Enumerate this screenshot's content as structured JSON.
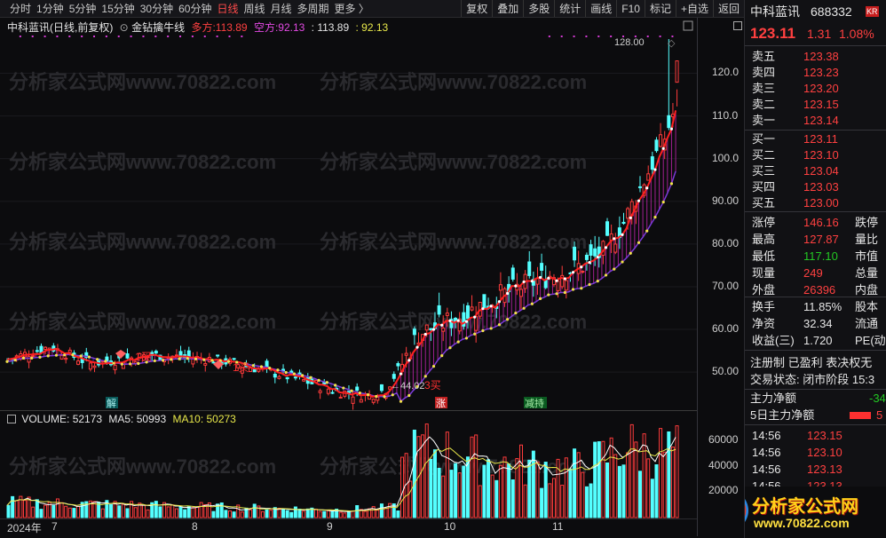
{
  "periods": [
    {
      "label": "分时"
    },
    {
      "label": "1分钟"
    },
    {
      "label": "5分钟"
    },
    {
      "label": "15分钟"
    },
    {
      "label": "30分钟"
    },
    {
      "label": "60分钟"
    },
    {
      "label": "日线",
      "active": true
    },
    {
      "label": "周线"
    },
    {
      "label": "月线"
    },
    {
      "label": "多周期"
    },
    {
      "label": "更多 〉"
    }
  ],
  "tools": [
    "复权",
    "叠加",
    "多股",
    "统计",
    "画线",
    "F10",
    "标记",
    "+自选",
    "返回"
  ],
  "legend": {
    "stock": "中科蓝讯(日线,前复权)",
    "indicator": "金钻擒牛线",
    "bull_label": "多方:",
    "bull_value": "113.89",
    "bear_label": "空方:",
    "bear_value": "92.13",
    "extra1": ": 113.89",
    "extra2": ": 92.13"
  },
  "price_axis": [
    "120.0",
    "110.0",
    "100.0",
    "90.00",
    "80.00",
    "70.00",
    "60.00",
    "50.00"
  ],
  "volume_axis": [
    "60000",
    "40000",
    "20000"
  ],
  "volume_legend": {
    "vol_label": "VOLUME: 52173",
    "ma5_label": "MA5: 50993",
    "ma10_label": "MA10: 50273"
  },
  "date_labels": [
    "2024年",
    "7",
    "8",
    "9",
    "10",
    "11"
  ],
  "annotations": {
    "high": "128.00",
    "low": "44.02",
    "buy_marks": [
      "1买",
      "1买"
    ],
    "buy3": "3买",
    "rise": "涨",
    "jie": "解",
    "jianchi": "减持"
  },
  "watermark": "分析家公式网www.70822.com",
  "chart_data": {
    "type": "candlestick",
    "title": "中科蓝讯(日线,前复权)",
    "y_range": [
      44,
      128
    ],
    "last": 113.89,
    "high": 128.0,
    "low": 44.02,
    "volume": {
      "value": 52173,
      "ma5": 50993,
      "ma10": 50273,
      "y_range": [
        0,
        70000
      ]
    },
    "anchors": [
      [
        0,
        53
      ],
      [
        10,
        56
      ],
      [
        20,
        52
      ],
      [
        35,
        54
      ],
      [
        50,
        53
      ],
      [
        60,
        51
      ],
      [
        72,
        48
      ],
      [
        80,
        45.5
      ],
      [
        88,
        44.5
      ],
      [
        92,
        46
      ],
      [
        96,
        52
      ],
      [
        100,
        59
      ],
      [
        110,
        63
      ],
      [
        120,
        68
      ],
      [
        130,
        72
      ],
      [
        140,
        75
      ],
      [
        145,
        78
      ],
      [
        150,
        85
      ],
      [
        155,
        95
      ],
      [
        160,
        105
      ],
      [
        163,
        113
      ]
    ],
    "vol_anchors": [
      [
        0,
        12000
      ],
      [
        40,
        9000
      ],
      [
        80,
        6000
      ],
      [
        95,
        8000
      ],
      [
        96,
        40000
      ],
      [
        100,
        55000
      ],
      [
        120,
        42000
      ],
      [
        140,
        38000
      ],
      [
        150,
        55000
      ],
      [
        163,
        52000
      ]
    ]
  },
  "quote": {
    "name": "中科蓝讯",
    "code": "688332",
    "kr": "KR",
    "price": "123.11",
    "change": "1.31",
    "pct": "1.08%",
    "asks": [
      {
        "l": "卖五",
        "p": "123.38"
      },
      {
        "l": "卖四",
        "p": "123.23"
      },
      {
        "l": "卖三",
        "p": "123.20"
      },
      {
        "l": "卖二",
        "p": "123.15"
      },
      {
        "l": "卖一",
        "p": "123.14"
      }
    ],
    "bids": [
      {
        "l": "买一",
        "p": "123.11"
      },
      {
        "l": "买二",
        "p": "123.10"
      },
      {
        "l": "买三",
        "p": "123.04"
      },
      {
        "l": "买四",
        "p": "123.03"
      },
      {
        "l": "买五",
        "p": "123.00"
      }
    ],
    "stats": [
      {
        "l": "涨停",
        "v": "146.16",
        "r": "跌停"
      },
      {
        "l": "最高",
        "v": "127.87",
        "r": "量比"
      },
      {
        "l": "最低",
        "v": "117.10",
        "r": "市值"
      },
      {
        "l": "现量",
        "v": "249",
        "r": "总量"
      },
      {
        "l": "外盘",
        "v": "26396",
        "r": "内盘"
      }
    ],
    "stats2": [
      {
        "l": "换手",
        "v": "11.85%",
        "r": "股本"
      },
      {
        "l": "净资",
        "v": "32.34",
        "r": "流通"
      },
      {
        "l": "收益(三)",
        "v": "1.720",
        "r": "PE(动"
      }
    ],
    "tags": "注册制 已盈利 表决权无",
    "status": "交易状态: 闭市阶段 15:3",
    "flow1": "主力净额",
    "flow1_val": "-34",
    "flow2": "5日主力净额",
    "flow2_val": "5",
    "ticks": [
      {
        "t": "14:56",
        "p": "123.15"
      },
      {
        "t": "14:56",
        "p": "123.10"
      },
      {
        "t": "14:56",
        "p": "123.13"
      },
      {
        "t": "14:56",
        "p": "123.13"
      }
    ]
  },
  "logo": {
    "name": "分析家公式网",
    "url": "www.70822.com"
  }
}
